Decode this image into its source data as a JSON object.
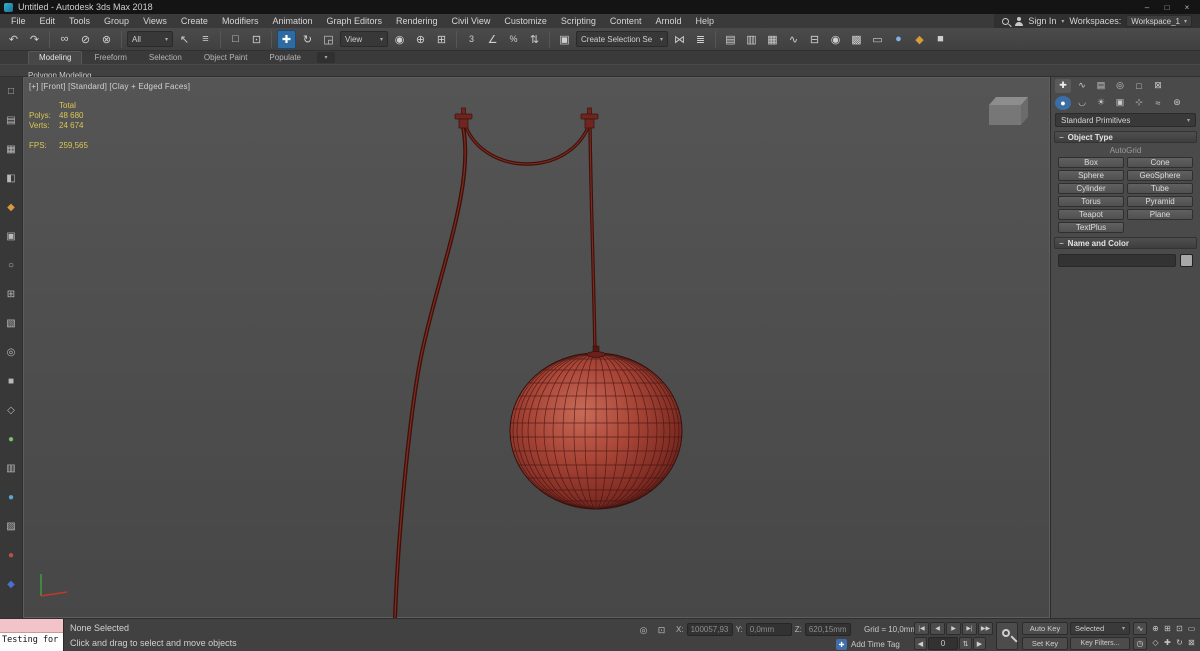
{
  "colors": {
    "accent_blue": "#2e6ba1",
    "viewport_bg": "#4c4c4c",
    "sphere_red": "#a84537",
    "status_blue": "#3f6ea8",
    "object_swatch": "#a8a8a8",
    "stats_yellow": "#dcc653"
  },
  "window": {
    "title": "Untitled - Autodesk 3ds Max 2018",
    "minimize": "–",
    "maximize": "□",
    "close": "×"
  },
  "menu": {
    "items": [
      "File",
      "Edit",
      "Tools",
      "Group",
      "Views",
      "Create",
      "Modifiers",
      "Animation",
      "Graph Editors",
      "Rendering",
      "Civil View",
      "Customize",
      "Scripting",
      "Content",
      "Arnold",
      "Help"
    ]
  },
  "account": {
    "sign_in": "Sign In",
    "workspaces_label": "Workspaces:",
    "workspace": "Workspace_1",
    "caret": "▾"
  },
  "toolbar": {
    "filter": "All",
    "coord": "View",
    "selection_set": "Create Selection Se",
    "caret": "▾",
    "icons": {
      "undo": "↶",
      "redo": "↷",
      "link": "∞",
      "unlink": "⊘",
      "bind": "⊗",
      "select": "↖",
      "by_name": "≡",
      "region": "□",
      "crossing": "⊡",
      "move": "✚",
      "rotate": "↻",
      "scale": "◲",
      "pivot": "◉",
      "manipulate": "⊕",
      "kbd": "⊞",
      "snap": "3",
      "angle": "∠",
      "percent": "%",
      "spinner": "⇅",
      "sets": "▣",
      "mirror": "⋈",
      "align": "≣",
      "scene_exp": "▤",
      "layer_exp": "▥",
      "ribbon": "▦",
      "curve": "∿",
      "schematic": "⊟",
      "material": "◉",
      "rsetup": "▩",
      "rfw": "▭",
      "render": "●",
      "cloud": "◆",
      "gallery": "■"
    }
  },
  "ribbon": {
    "tabs": [
      "Modeling",
      "Freeform",
      "Selection",
      "Object Paint",
      "Populate"
    ],
    "more": "▾",
    "subbar": "Polygon Modeling"
  },
  "left_toolbar": {
    "icons": [
      {
        "g": "□"
      },
      {
        "g": "▤"
      },
      {
        "g": "▦"
      },
      {
        "g": "◧"
      },
      {
        "g": "◆"
      },
      {
        "g": "▣"
      },
      {
        "g": "○"
      },
      {
        "g": "⊞"
      },
      {
        "g": "▧"
      },
      {
        "g": "◎"
      },
      {
        "g": "■"
      },
      {
        "g": "◇"
      },
      {
        "g": "●"
      },
      {
        "g": "▥"
      },
      {
        "g": "●"
      },
      {
        "g": "▨"
      },
      {
        "g": "●"
      },
      {
        "g": "◆"
      }
    ]
  },
  "viewport": {
    "label": "[+] [Front] [Standard] [Clay + Edged Faces]",
    "stats": {
      "total": "Total",
      "polys_label": "Polys:",
      "polys": "48 680",
      "verts_label": "Verts:",
      "verts": "24 674",
      "fps_label": "FPS:",
      "fps": "259,565"
    }
  },
  "panel": {
    "tabs": [
      {
        "g": "✚"
      },
      {
        "g": "∿"
      },
      {
        "g": "▤"
      },
      {
        "g": "◎"
      },
      {
        "g": "□"
      },
      {
        "g": "⊠"
      }
    ],
    "cats": [
      {
        "g": "●"
      },
      {
        "g": "◡"
      },
      {
        "g": "☀"
      },
      {
        "g": "▣"
      },
      {
        "g": "⊹"
      },
      {
        "g": "≈"
      },
      {
        "g": "⊛"
      }
    ],
    "dropdown": "Standard Primitives",
    "collapse": "−",
    "object_type": {
      "title": "Object Type",
      "autogrid": "AutoGrid",
      "buttons": [
        "Box",
        "Cone",
        "Sphere",
        "GeoSphere",
        "Cylinder",
        "Tube",
        "Torus",
        "Pyramid",
        "Teapot",
        "Plane",
        "TextPlus"
      ]
    },
    "name_color": {
      "title": "Name and Color"
    }
  },
  "status": {
    "selection": "None Selected",
    "prompt": "Click and drag to select and move objects",
    "x_label": "X:",
    "x_value": "100057,93",
    "y_label": "Y:",
    "y_value": "0,0mm",
    "z_label": "Z:",
    "z_value": "620,15mm",
    "grid": "Grid = 10,0mm",
    "add_time_tag": "Add Time Tag",
    "auto_key": "Auto Key",
    "set_key": "Set Key",
    "selected": "Selected",
    "key_filters": "Key Filters...",
    "frame": "0",
    "playback": {
      "start": "|◀",
      "prev": "◀",
      "play": "▶",
      "next": "▶|",
      "end": "▶▶"
    },
    "nav": {
      "zoom": "⊕",
      "zoom_all": "⊞",
      "zoom_ext": "⊡",
      "zoom_region": "▭",
      "fov": "◇",
      "pan": "✚",
      "orbit": "↻",
      "maximize": "⊠"
    },
    "misc": {
      "isolate": "◎",
      "lock": "⊡",
      "tangent": "∿",
      "timecfg": "◷",
      "spin": "⇅",
      "add": "✚"
    }
  },
  "listener": {
    "text": "Testing for i"
  }
}
